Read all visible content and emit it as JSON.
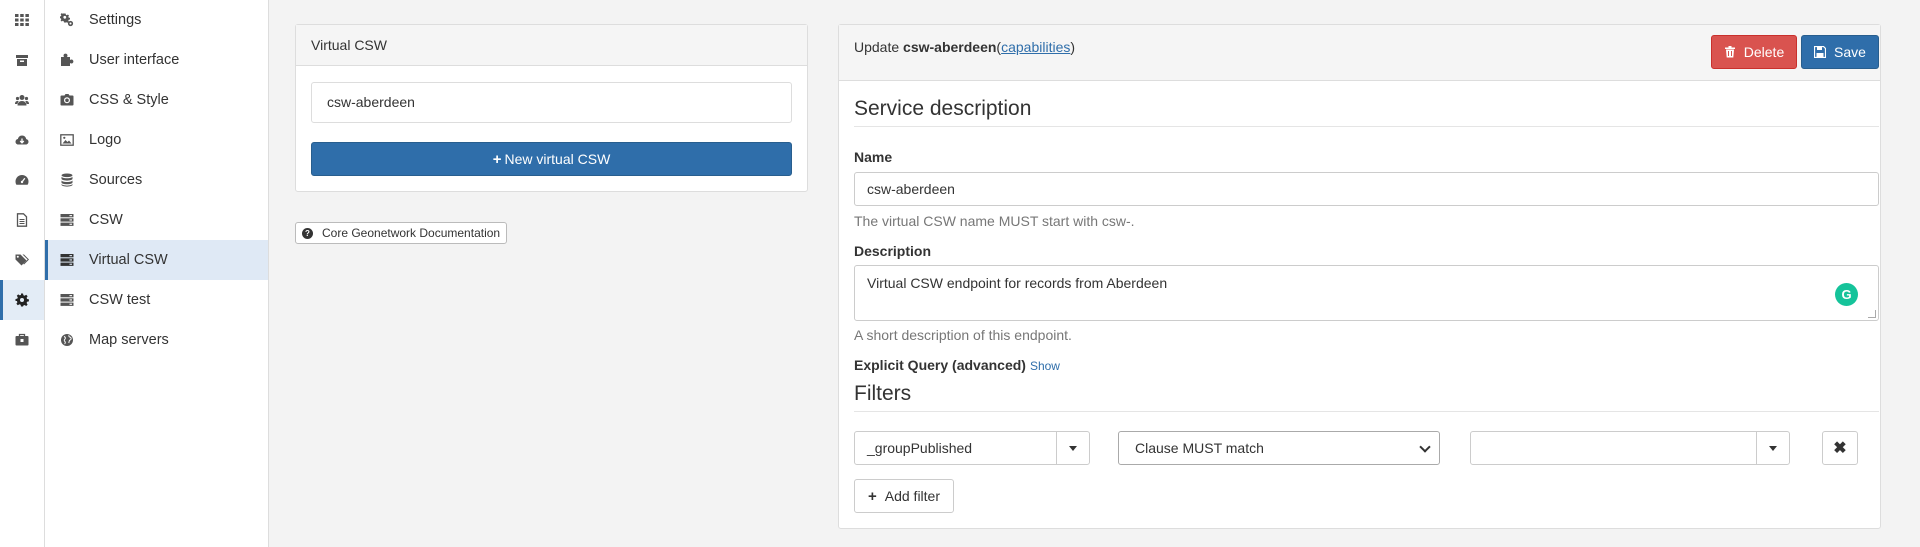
{
  "rail": {
    "items": [
      {
        "icon": "apps-grid-icon",
        "active": false
      },
      {
        "icon": "archive-icon",
        "active": false
      },
      {
        "icon": "users-icon",
        "active": false
      },
      {
        "icon": "cloud-download-icon",
        "active": false
      },
      {
        "icon": "dashboard-icon",
        "active": false
      },
      {
        "icon": "document-icon",
        "active": false
      },
      {
        "icon": "tags-icon",
        "active": false
      },
      {
        "icon": "gear-icon",
        "active": true
      },
      {
        "icon": "briefcase-icon",
        "active": false
      }
    ]
  },
  "menu": {
    "items": [
      {
        "label": "Settings",
        "icon": "gears-icon"
      },
      {
        "label": "User interface",
        "icon": "puzzle-icon"
      },
      {
        "label": "CSS & Style",
        "icon": "camera-icon"
      },
      {
        "label": "Logo",
        "icon": "image-icon"
      },
      {
        "label": "Sources",
        "icon": "database-icon"
      },
      {
        "label": "CSW",
        "icon": "server-icon"
      },
      {
        "label": "Virtual CSW",
        "icon": "server-icon",
        "active": true
      },
      {
        "label": "CSW test",
        "icon": "server-icon"
      },
      {
        "label": "Map servers",
        "icon": "globe-icon"
      }
    ]
  },
  "virtual_csw_panel": {
    "title": "Virtual CSW",
    "items": [
      "csw-aberdeen"
    ],
    "new_button": "New virtual CSW"
  },
  "doc_button": "Core Geonetwork Documentation",
  "editor": {
    "heading_prefix": "Update",
    "heading_name": "csw-aberdeen",
    "heading_link_open": "(",
    "heading_link": "capabilities",
    "heading_link_close": ")",
    "delete_label": "Delete",
    "save_label": "Save",
    "service_description_title": "Service description",
    "name_label": "Name",
    "name_value": "csw-aberdeen",
    "name_help": "The virtual CSW name MUST start with csw-.",
    "description_label": "Description",
    "description_value": "Virtual CSW endpoint for records from Aberdeen",
    "description_help": "A short description of this endpoint.",
    "explicit_query_label": "Explicit Query (advanced)",
    "explicit_query_toggle": "Show",
    "filters_title": "Filters",
    "filter": {
      "field": "_groupPublished",
      "clause": "Clause MUST match",
      "value": ""
    },
    "add_filter_label": "Add filter"
  },
  "colors": {
    "primary": "#2f6eaa",
    "danger": "#d9534f",
    "grammarly": "#15c39a"
  }
}
